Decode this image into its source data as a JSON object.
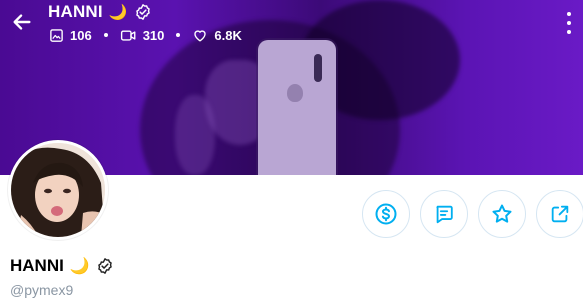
{
  "header": {
    "title": "HANNI",
    "title_emoji": "🌙",
    "back_icon": "arrow-left-icon",
    "verified_icon": "verified-badge-icon",
    "more_icon": "more-vertical-icon",
    "stats": [
      {
        "icon": "image-icon",
        "value": "106"
      },
      {
        "icon": "video-icon",
        "value": "310"
      },
      {
        "icon": "heart-icon",
        "value": "6.8K"
      }
    ]
  },
  "profile": {
    "name": "HANNI",
    "name_emoji": "🌙",
    "handle": "@pymex9",
    "verified_icon": "verified-badge-icon"
  },
  "actions": [
    {
      "name": "tip-button",
      "icon": "dollar-icon"
    },
    {
      "name": "message-button",
      "icon": "message-icon"
    },
    {
      "name": "favorite-button",
      "icon": "star-icon"
    },
    {
      "name": "share-button",
      "icon": "share-icon"
    }
  ],
  "colors": {
    "accent": "#00aff0",
    "banner": "#5a12b0",
    "muted_text": "#8a96a3"
  }
}
